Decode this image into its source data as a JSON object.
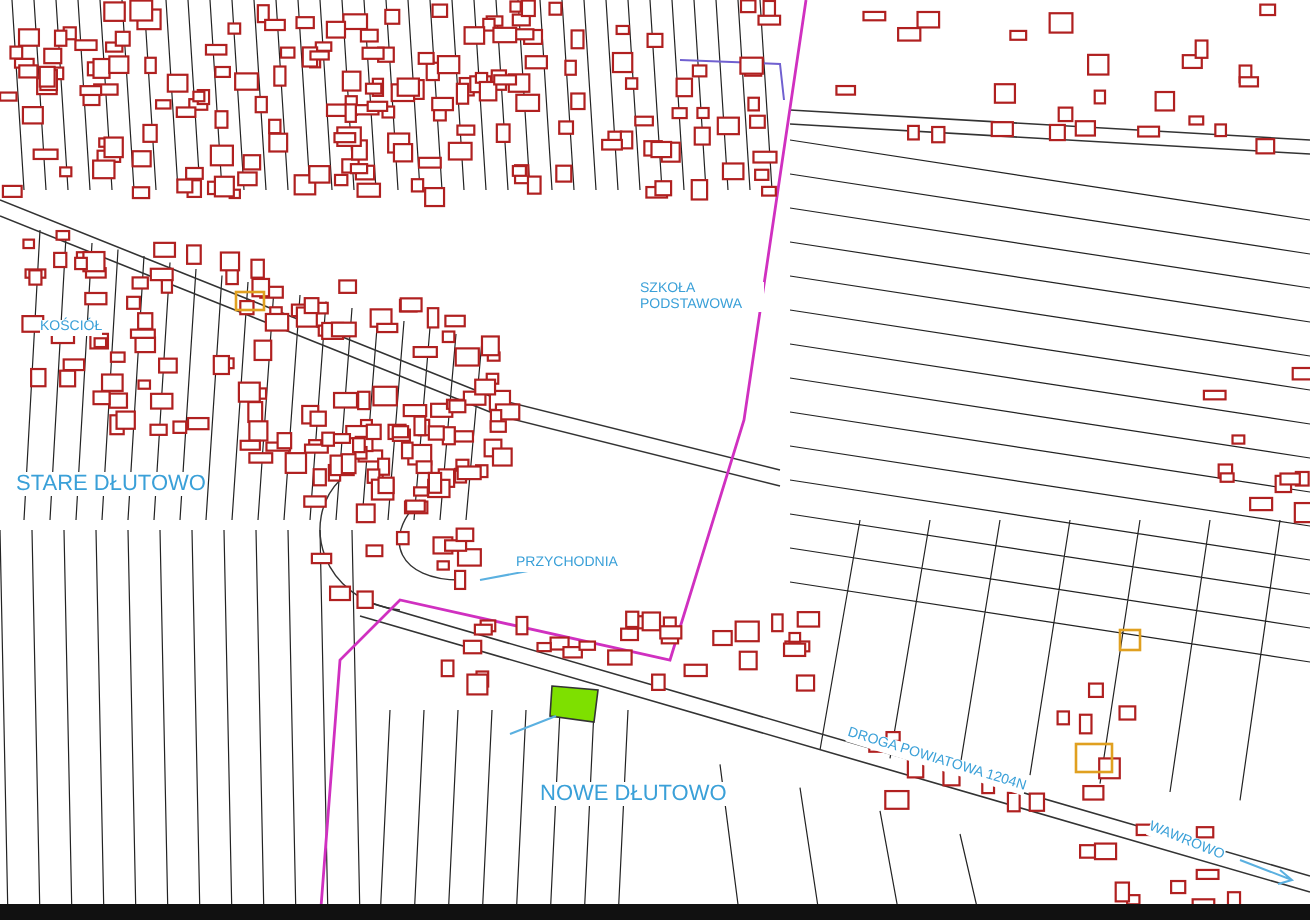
{
  "map": {
    "labels": [
      {
        "text": "KOŚCIÓŁ",
        "kind": "facility"
      },
      {
        "text": "STARE DŁUTOWO",
        "kind": "area"
      },
      {
        "text": "SZKOŁA PODSTAWOWA",
        "kind": "facility"
      },
      {
        "text": "PRZYCHODNIA",
        "kind": "facility"
      },
      {
        "text": "NOWE DŁUTOWO",
        "kind": "area"
      },
      {
        "text": "DROGA POWIATOWA 1204N",
        "kind": "road"
      },
      {
        "text": "WAWROWO",
        "kind": "road"
      }
    ]
  }
}
